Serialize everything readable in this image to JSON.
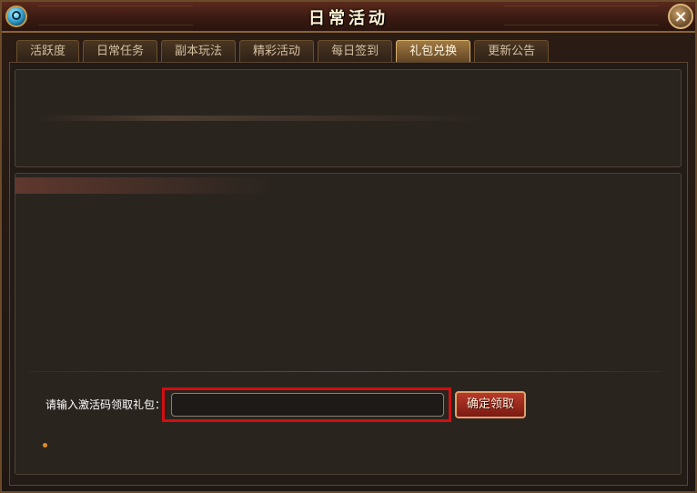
{
  "window": {
    "title": "日常活动",
    "close_symbol": "×"
  },
  "tabs": [
    {
      "label": "活跃度",
      "active": false
    },
    {
      "label": "日常任务",
      "active": false
    },
    {
      "label": "副本玩法",
      "active": false
    },
    {
      "label": "精彩活动",
      "active": false
    },
    {
      "label": "每日签到",
      "active": false
    },
    {
      "label": "礼包兑换",
      "active": true
    },
    {
      "label": "更新公告",
      "active": false
    }
  ],
  "redeem": {
    "label": "请输入激活码领取礼包：",
    "input_value": "",
    "input_placeholder": "",
    "button_label": "确定领取"
  },
  "colors": {
    "highlight": "#d20f12",
    "accent_gold": "#d7b06a",
    "button_red": "#b83a2a"
  }
}
